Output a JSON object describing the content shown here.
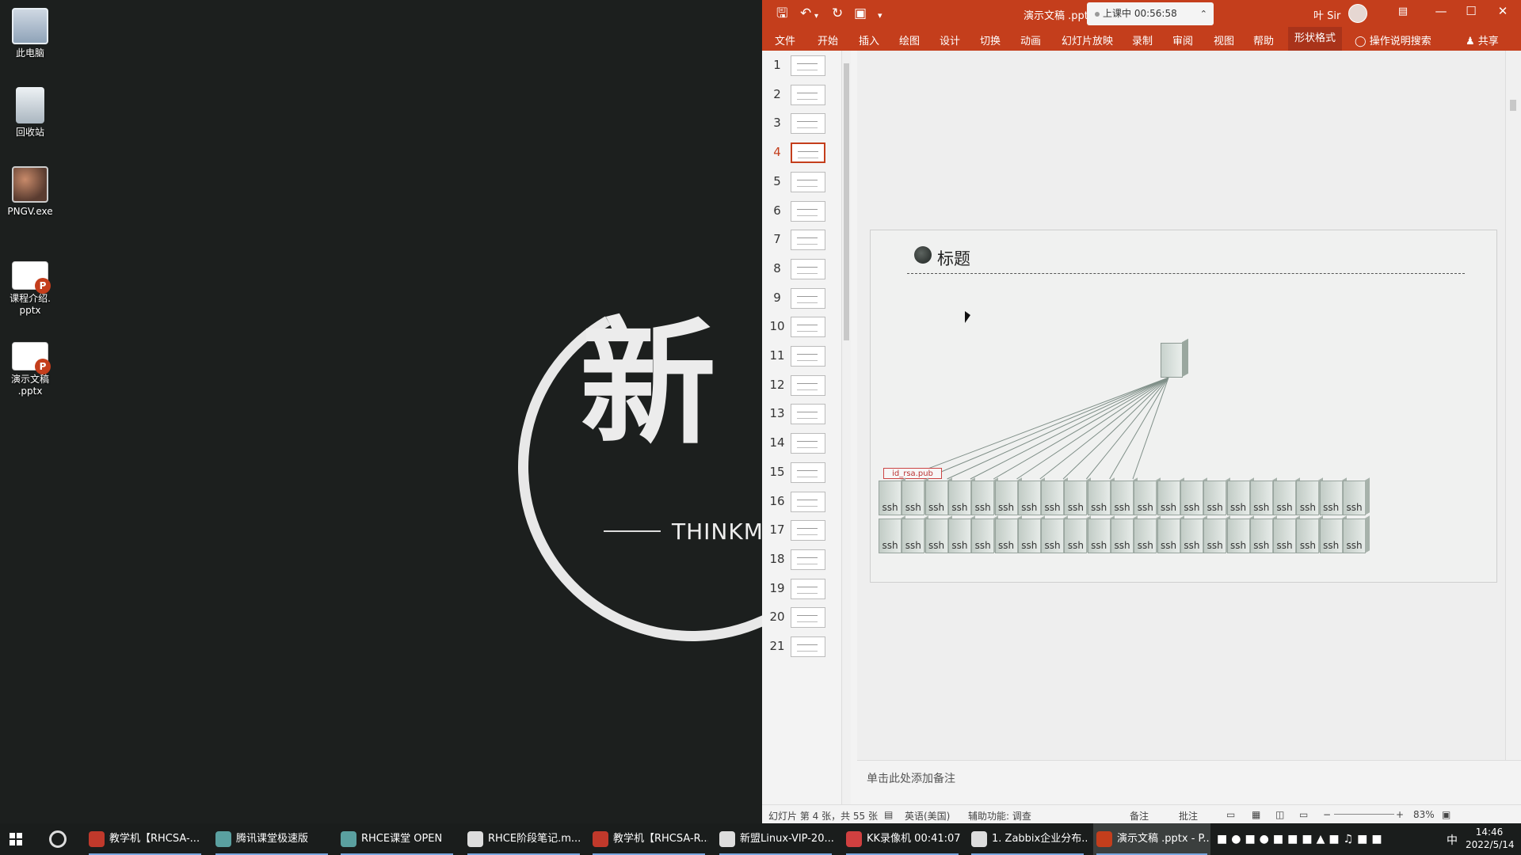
{
  "desktop": {
    "icons": [
      {
        "label": "此电脑",
        "icon": "computer-icon"
      },
      {
        "label": "回收站",
        "icon": "recycle-bin-icon"
      },
      {
        "label": "PNGV.exe",
        "icon": "png-viewer-icon"
      },
      {
        "label": "课程介绍.\npptx",
        "icon": "pptx-file-icon"
      },
      {
        "label": "演示文稿\n.pptx",
        "icon": "pptx-file-icon"
      }
    ],
    "wallpaper": {
      "char": "新",
      "text": "THINKMO"
    }
  },
  "ppt": {
    "title": "演示文稿 .pptx",
    "class_status": "上课中 00:56:58",
    "user": "叶 Sir",
    "tabs": [
      "文件",
      "开始",
      "插入",
      "绘图",
      "设计",
      "切换",
      "动画",
      "幻灯片放映",
      "录制",
      "审阅",
      "视图",
      "帮助",
      "形状格式"
    ],
    "active_tab": "形状格式",
    "tell_me": "操作说明搜索",
    "share": "共享",
    "thumbnails": [
      1,
      2,
      3,
      4,
      5,
      6,
      7,
      8,
      9,
      10,
      11,
      12,
      13,
      14,
      15,
      16,
      17,
      18,
      19,
      20,
      21
    ],
    "active_slide": 4,
    "slide": {
      "title": "标题",
      "key_label": "id_rsa.pub",
      "node_label": "ssh",
      "node_columns": 21,
      "node_rows": 2,
      "connected_nodes": 11
    },
    "notes_placeholder": "单击此处添加备注",
    "status": {
      "slide_info": "幻灯片 第 4 张，共 55 张",
      "language": "英语(美国)",
      "accessibility": "辅助功能: 调查",
      "notes": "备注",
      "comments": "批注",
      "zoom": "83%"
    }
  },
  "taskbar": {
    "items": [
      {
        "label": "教学机【RHCSA-...",
        "color": "#c0392b"
      },
      {
        "label": "腾讯课堂极速版",
        "color": "#5aa0a0"
      },
      {
        "label": "RHCE课堂 OPEN",
        "color": "#5aa0a0"
      },
      {
        "label": "RHCE阶段笔记.m...",
        "color": "#dddddd"
      },
      {
        "label": "教学机【RHCSA-R...",
        "color": "#c0392b"
      },
      {
        "label": "新盟Linux-VIP-20...",
        "color": "#dddddd"
      },
      {
        "label": "KK录像机 00:41:07",
        "color": "#d04040"
      },
      {
        "label": "1. Zabbix企业分布...",
        "color": "#dddddd"
      },
      {
        "label": "演示文稿 .pptx - P...",
        "color": "#c43e1c"
      }
    ],
    "ime": "中",
    "time": "14:46",
    "date": "2022/5/14"
  }
}
